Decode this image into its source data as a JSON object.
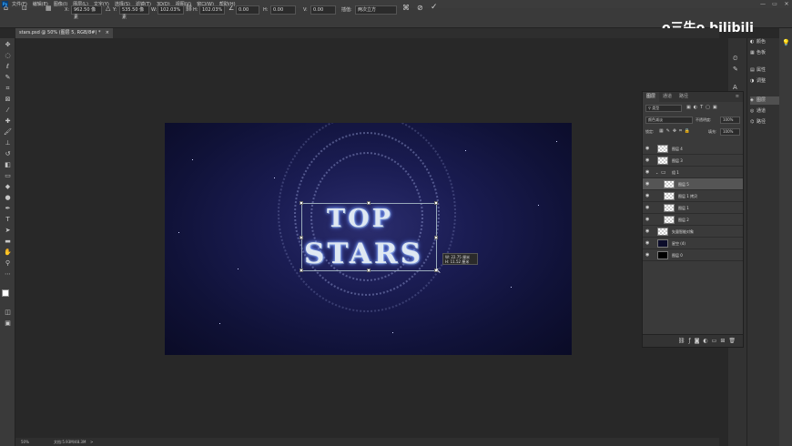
{
  "menubar": {
    "app_icon": "Ps",
    "items": [
      "文件(F)",
      "编辑(E)",
      "图像(I)",
      "图层(L)",
      "文字(Y)",
      "选择(S)",
      "滤镜(T)",
      "3D(D)",
      "视图(V)",
      "窗口(W)",
      "帮助(H)"
    ],
    "window_controls": [
      "—",
      "▭",
      "✕"
    ]
  },
  "options": {
    "x_label": "X:",
    "x_value": "962.50 像素",
    "y_label": "Y:",
    "y_value": "535.50 像素",
    "w_label": "W:",
    "w_value": "102.03%",
    "h_label": "H:",
    "h_value": "102.03%",
    "angle_value": "0.00",
    "hskew_label": "H:",
    "hskew_value": "0.00",
    "vskew_label": "V:",
    "vskew_value": "0.00",
    "interp_label": "插值:",
    "interp_value": "两次立方",
    "cancel_icon": "cancel-icon",
    "commit_icon": "check-icon"
  },
  "document": {
    "tab_title": "stars.psd @ 50% (图层 5, RGB/8#) *",
    "tab_close": "×"
  },
  "artwork": {
    "line1": "TOP",
    "line2": "STARS"
  },
  "transform_tooltip": {
    "w": "W:  22.75 厘米",
    "h": "H:  11.52 厘米"
  },
  "status": {
    "zoom": "50%",
    "doc_info": "文档:5.93M/48.3M",
    "arrow": ">"
  },
  "right_panels": [
    {
      "label": "颜色",
      "icon": "palette-icon"
    },
    {
      "label": "色板",
      "icon": "swatches-icon"
    },
    {
      "label": "属性",
      "icon": "properties-icon"
    },
    {
      "label": "调整",
      "icon": "adjustments-icon"
    },
    {
      "label": "图层",
      "icon": "layers-icon"
    },
    {
      "label": "通道",
      "icon": "channels-icon"
    },
    {
      "label": "路径",
      "icon": "paths-icon"
    }
  ],
  "layers_panel": {
    "tabs": [
      "图层",
      "通道",
      "路径"
    ],
    "filter_label": "类型",
    "blend_mode": "颜色减淡",
    "opacity_label": "不透明度:",
    "opacity_value": "100%",
    "lock_label": "锁定:",
    "fill_label": "填充:",
    "fill_value": "100%",
    "layers": [
      {
        "name": "图层 4",
        "thumb": "checker",
        "indent": 0,
        "selected": false
      },
      {
        "name": "图层 3",
        "thumb": "checker",
        "indent": 0,
        "selected": false
      },
      {
        "name": "组 1",
        "thumb": "folder",
        "indent": 0,
        "selected": false
      },
      {
        "name": "图层 5",
        "thumb": "checker",
        "indent": 1,
        "selected": true
      },
      {
        "name": "图层 1 拷贝",
        "thumb": "checker",
        "indent": 1,
        "selected": false
      },
      {
        "name": "图层 1",
        "thumb": "checker",
        "indent": 1,
        "selected": false
      },
      {
        "name": "图层 2",
        "thumb": "checker",
        "indent": 1,
        "selected": false
      },
      {
        "name": "矢量智能对象",
        "thumb": "checker",
        "indent": 0,
        "selected": false
      },
      {
        "name": "星空 (4)",
        "thumb": "dark",
        "indent": 0,
        "selected": false
      },
      {
        "name": "图层 0",
        "thumb": "black",
        "indent": 0,
        "selected": false
      }
    ],
    "footer_icons": [
      "link-icon",
      "fx-icon",
      "mask-icon",
      "adjustment-layer-icon",
      "group-icon",
      "new-layer-icon",
      "trash-icon"
    ]
  },
  "watermark": "o三牛o bilibili",
  "colors": {
    "accent": "#31a8ff",
    "ui_bg": "#3a3a3a",
    "canvas_bg": "#282828"
  }
}
